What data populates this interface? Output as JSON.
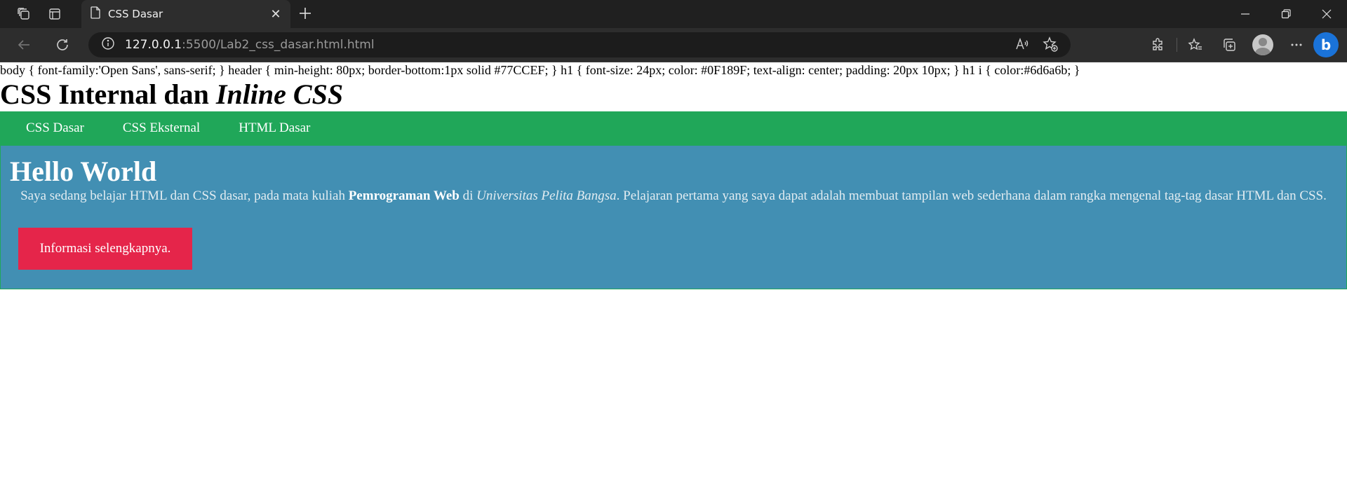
{
  "browser": {
    "tab_title": "CSS Dasar",
    "url_host": "127.0.0.1",
    "url_rest": ":5500/Lab2_css_dasar.html.html"
  },
  "page": {
    "css_source": "body { font-family:'Open Sans', sans-serif; } header { min-height: 80px; border-bottom:1px solid #77CCEF; } h1 { font-size: 24px; color: #0F189F; text-align: center; padding: 20px 10px; } h1 i { color:#6d6a6b; }",
    "title_plain": "CSS Internal dan ",
    "title_italic": "Inline CSS",
    "nav": [
      "CSS Dasar",
      "CSS Eksternal",
      "HTML Dasar"
    ],
    "hero": {
      "title": "Hello World",
      "text_1": "Saya sedang belajar HTML dan CSS dasar, pada mata kuliah ",
      "text_bold": "Pemrograman Web",
      "text_2": " di ",
      "text_italic": "Universitas Pelita Bangsa",
      "text_3": ". Pelajaran pertama yang saya dapat adalah membuat tampilan web sederhana dalam rangka mengenal tag-tag dasar HTML dan CSS.",
      "button": "Informasi selengkapnya."
    }
  },
  "colors": {
    "nav_bg": "#20a759",
    "hero_bg": "#428fb3",
    "button_bg": "#e5254a"
  }
}
